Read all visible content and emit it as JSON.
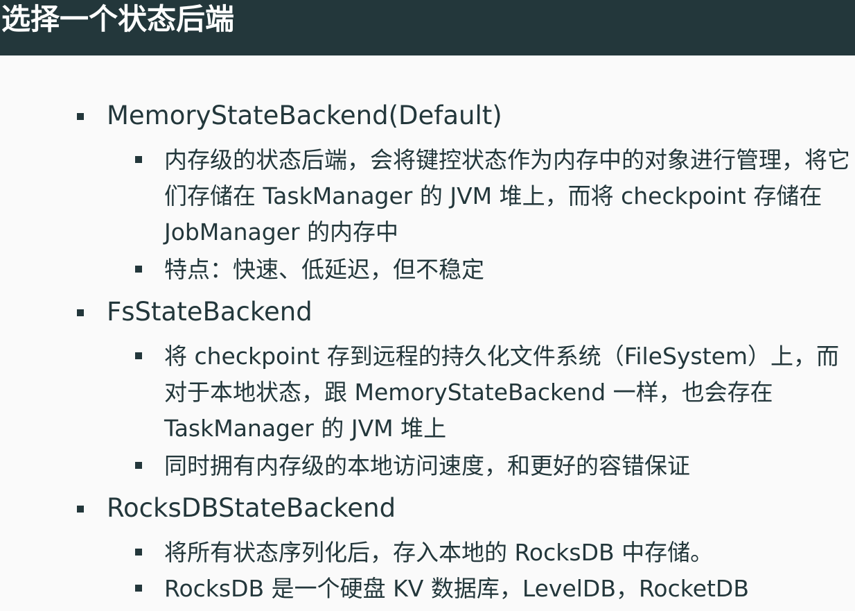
{
  "title": "选择一个状态后端",
  "sections": [
    {
      "heading": "MemoryStateBackend(Default)",
      "items": [
        "内存级的状态后端，会将键控状态作为内存中的对象进行管理，将它们存储在 TaskManager 的 JVM 堆上，而将 checkpoint 存储在 JobManager 的内存中",
        "特点：快速、低延迟，但不稳定"
      ]
    },
    {
      "heading": "FsStateBackend",
      "items": [
        "将 checkpoint 存到远程的持久化文件系统（FileSystem）上，而对于本地状态，跟 MemoryStateBackend 一样，也会存在 TaskManager 的 JVM 堆上",
        "同时拥有内存级的本地访问速度，和更好的容错保证"
      ]
    },
    {
      "heading": "RocksDBStateBackend",
      "items": [
        "将所有状态序列化后，存入本地的 RocksDB 中存储。",
        "RocksDB 是一个硬盘 KV 数据库，LevelDB，RocketDB"
      ]
    }
  ]
}
